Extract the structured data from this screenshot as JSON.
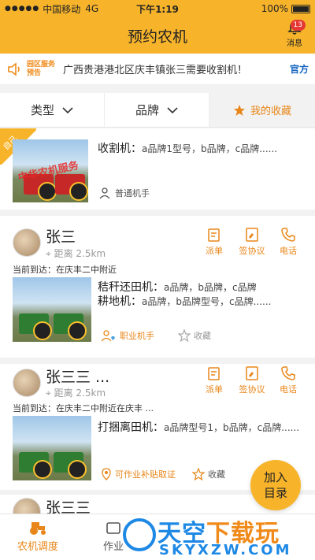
{
  "status_bar": {
    "carrier": "中国移动",
    "network": "4G",
    "time": "下午1:19",
    "battery": "100%"
  },
  "header": {
    "title": "预约农机",
    "messages_label": "消息",
    "messages_count": "13"
  },
  "notice": {
    "tag": "园区服务预告",
    "text": "广西贵港港北区庆丰镇张三需要收割机！",
    "official": "官方"
  },
  "filters": {
    "type_label": "类型",
    "brand_label": "品牌",
    "favorites_label": "我的收藏"
  },
  "listings": [
    {
      "corner_tag": "自己",
      "watermark": "中华农机服务",
      "machine_lines": [
        {
          "label": "收割机：",
          "value": "a品牌1型号，b品牌，c品牌......"
        }
      ],
      "operator": "普通机手"
    },
    {
      "name": "张三",
      "distance": "距离 2.5km",
      "location": "当前到达：在庆丰二中附近",
      "actions": [
        "派单",
        "签协议",
        "电话"
      ],
      "machine_lines": [
        {
          "label": "秸秆还田机：",
          "value": "a品牌，b品牌，c品牌"
        },
        {
          "label": "耕地机：",
          "value": "a品牌，b品牌型号，c品牌......"
        }
      ],
      "operator": "职业机手",
      "favorite": "收藏"
    },
    {
      "name": "张三三 ...",
      "distance": "距离 2.5km",
      "location": "当前到达：在庆丰二中附近在庆丰 ...",
      "actions": [
        "派单",
        "签协议",
        "电话"
      ],
      "machine_lines": [
        {
          "label": "打捆离田机：",
          "value": "a品牌型号1，b品牌，c品牌......"
        }
      ],
      "operator": "可作业补贴取证",
      "favorite": "收藏"
    },
    {
      "name": "张三三"
    }
  ],
  "fab": {
    "line1": "加入",
    "line2": "目录"
  },
  "tabs": [
    {
      "label": "农机调度"
    },
    {
      "label": "作业"
    }
  ],
  "watermark": {
    "cn_a": "天空",
    "cn_b": "下载玩",
    "en": "SKYXZW.COM"
  },
  "colors": {
    "brand": "#f7b42b",
    "accent": "#e8861a",
    "badge": "#e53935"
  }
}
